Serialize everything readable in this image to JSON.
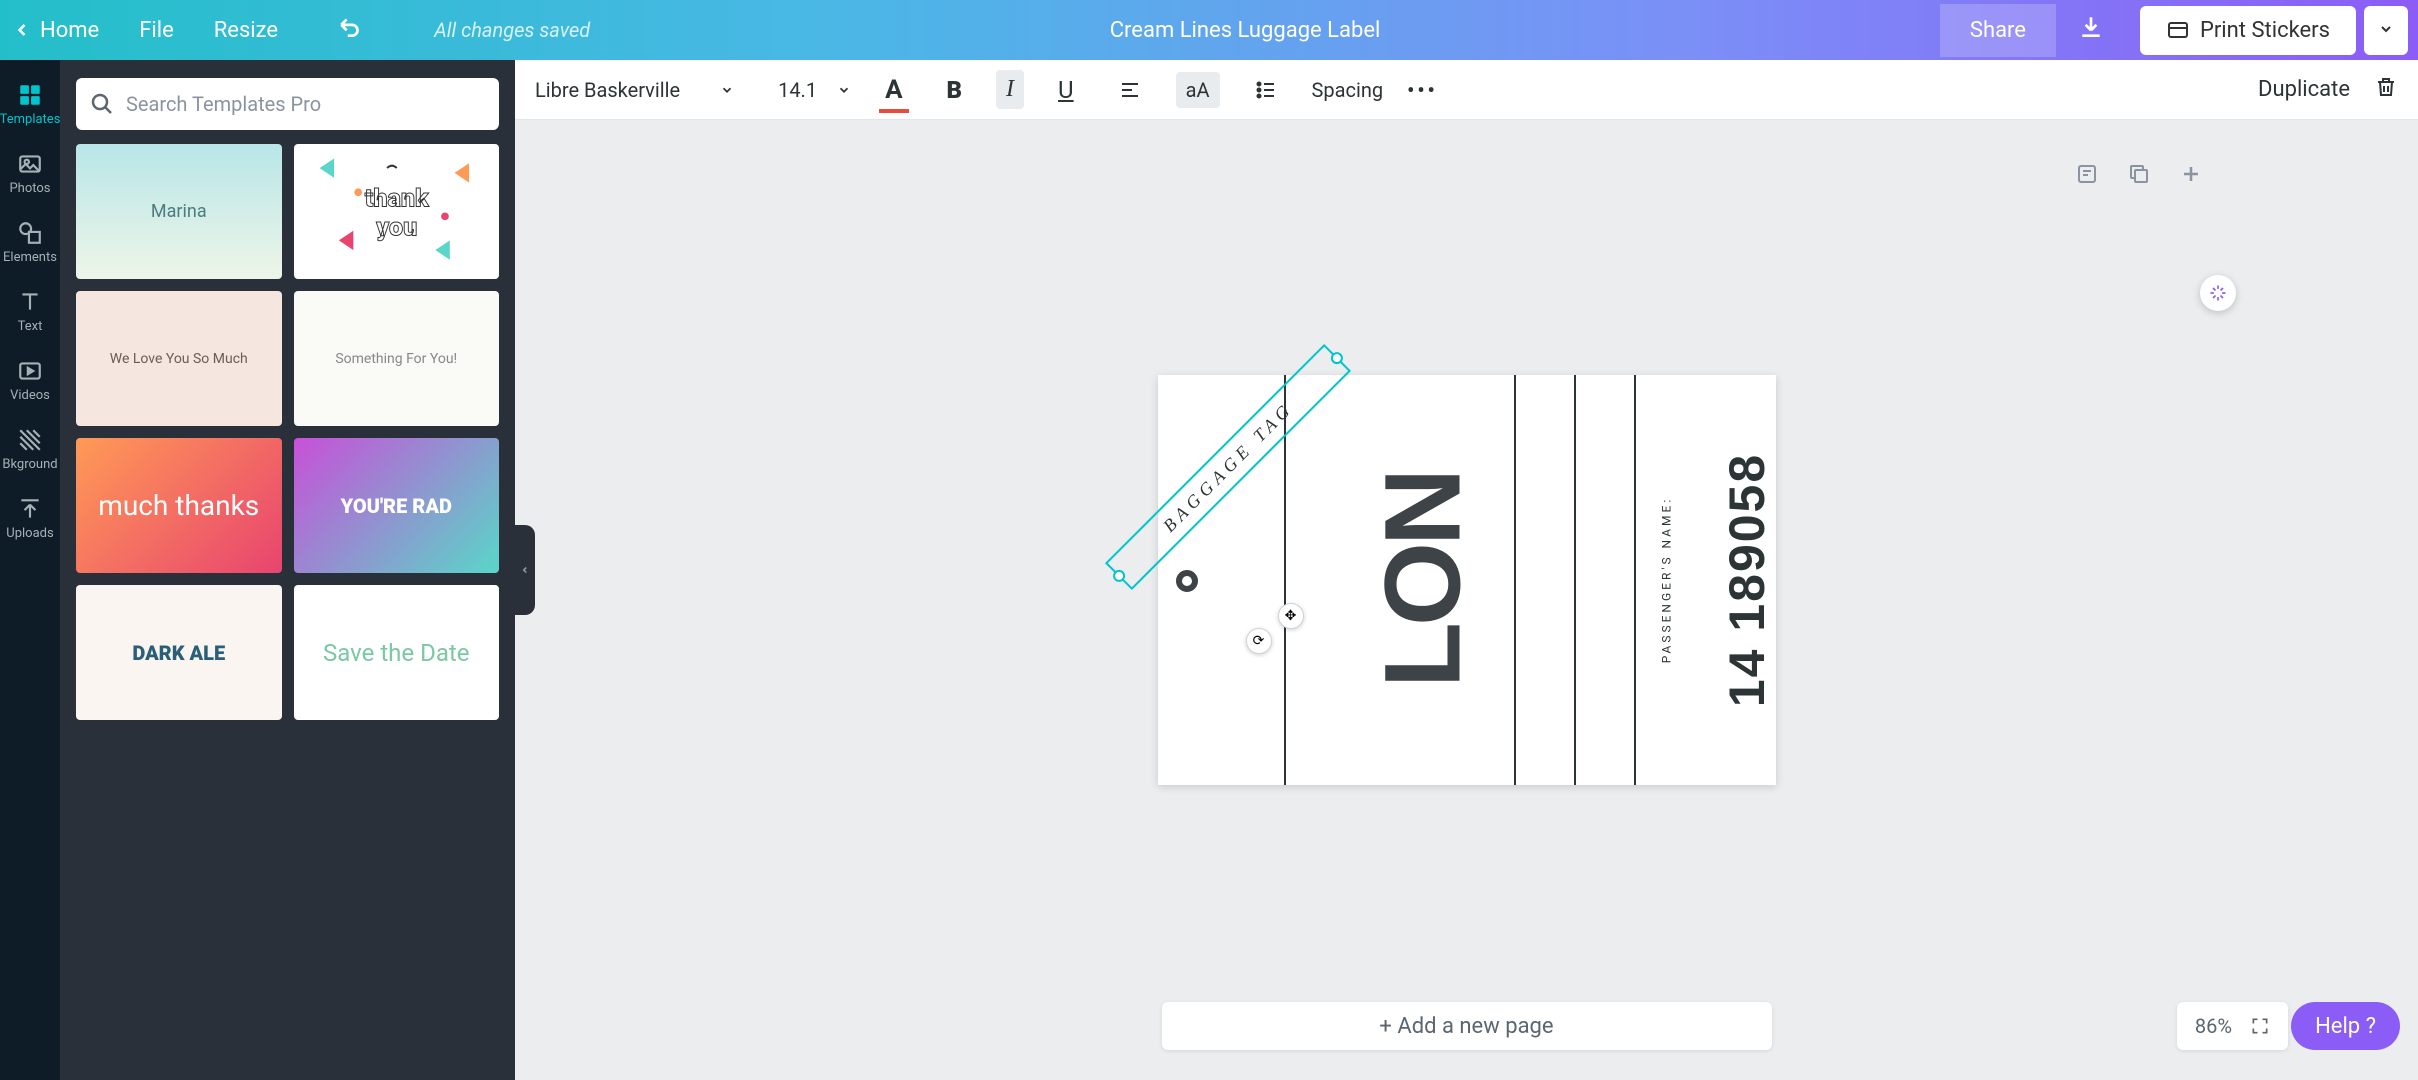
{
  "topbar": {
    "home": "Home",
    "file": "File",
    "resize": "Resize",
    "save_status": "All changes saved",
    "doc_name": "Cream Lines Luggage Label",
    "share": "Share",
    "print": "Print Stickers"
  },
  "rail": {
    "templates": "Templates",
    "photos": "Photos",
    "elements": "Elements",
    "text": "Text",
    "videos": "Videos",
    "background": "Bkground",
    "uploads": "Uploads"
  },
  "search": {
    "placeholder": "Search Templates Pro"
  },
  "templates": [
    {
      "label": "Marina"
    },
    {
      "label": "thank you"
    },
    {
      "label": "We Love You So Much"
    },
    {
      "label": "Something For You!"
    },
    {
      "label": "much thanks"
    },
    {
      "label": "YOU'RE RAD"
    },
    {
      "label": "DARK ALE"
    },
    {
      "label": "Save the Date"
    }
  ],
  "toolbar": {
    "font": "Libre Baskerville",
    "font_size": "14.1",
    "spacing": "Spacing",
    "duplicate": "Duplicate"
  },
  "canvas": {
    "baggage": "BAGGAGE TAG",
    "lon": "LON",
    "passenger": "PASSENGER'S NAME:",
    "serial": "14 189058"
  },
  "bottom": {
    "add_page": "+ Add a new page",
    "zoom": "86%",
    "help": "Help ?"
  }
}
